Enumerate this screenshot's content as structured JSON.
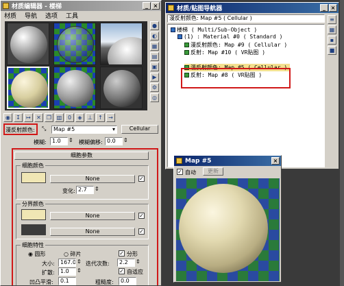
{
  "material_editor": {
    "title": "材质编辑器 - 楼梯",
    "menu": [
      "材质",
      "导航",
      "选项",
      "工具"
    ],
    "map_label": "漫反射颜色:",
    "map_name": "Map #5",
    "map_type": "Cellular",
    "blur_label": "模糊:",
    "blur_value": "1.0",
    "blur_offset_label": "模糊偏移:",
    "blur_offset_value": "0.0",
    "rollout_title": "细胞参数",
    "cell_color_group": "细胞颜色",
    "none_label": "None",
    "variation_label": "变化:",
    "variation_value": "2.7",
    "divider_group": "分界颜色",
    "characteristics_group": "细胞特性",
    "circular_label": "圆形",
    "chips_label": "碎片",
    "fractal_label": "分形",
    "size_label": "大小:",
    "size_value": "167.0",
    "iterations_label": "迭代次数:",
    "iterations_value": "2.2",
    "spread_label": "扩散:",
    "spread_value": "1.0",
    "adaptive_label": "自适应",
    "bump_label": "凹凸平滑:",
    "bump_value": "0.1",
    "roughness_label": "粗糙度:",
    "roughness_value": "0.0",
    "colors": {
      "swatch_cream": "#f0e6b4",
      "swatch_dark": "#3c3c3c"
    }
  },
  "navigator": {
    "title": "材质/贴图导航器",
    "header": "漫反射颜色: Map #5   ( Cellular )",
    "tree": [
      "楼梯   ( Multi/Sub-Object )",
      "(1) : Material #0  ( Standard )",
      "漫反射颜色: Map #9   ( Cellular )",
      "反射: Map #10   ( VR贴图 )",
      "漫反射颜色: Map #5   ( Cellular )",
      "反射: Map #8   ( VR贴图 )"
    ]
  },
  "map_preview": {
    "title": "Map #5",
    "auto_label": "自动",
    "update_label": "更新"
  },
  "colors": {
    "highlight_red": "#d01818",
    "title_blue": "#0a246a"
  }
}
